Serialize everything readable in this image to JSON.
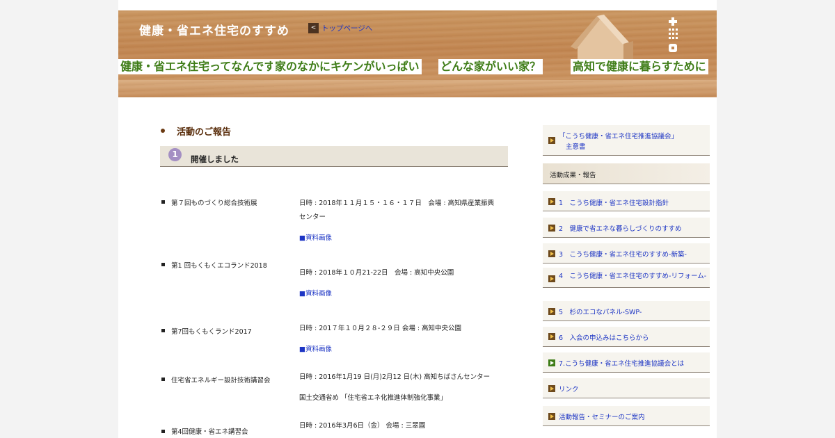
{
  "header": {
    "site_title": "健康・省エネ住宅のすすめ",
    "top_link": {
      "arrow": "<",
      "label": "トップページへ"
    },
    "nav": [
      "健康・省エネ住宅ってなんですか？",
      "家のなかにキケンがいっぱい",
      "どんな家がいい家？",
      "高知で健康に暮らすために"
    ]
  },
  "main": {
    "section_title": "活動のご報告",
    "banner": {
      "number": "1",
      "title": "開催しました"
    },
    "events": [
      {
        "name": "第７回ものづくり総合技術展",
        "lines": [
          "日時 : 2018年１１月１５・１６・１７日　会場 : 高知県産業振興",
          "センター"
        ],
        "link": "■資料画像"
      },
      {
        "name": "第1 回もくもくエコランド2018",
        "lines": [
          "日時 : 2018年１０月21-22日　会場 : 高知中央公園"
        ],
        "link": "■資料画像"
      },
      {
        "name": "第7回もくもくランド2017",
        "lines": [
          "日時 : 201７年１０月２８-２９日 会場 : 高知中央公園"
        ],
        "link": "■資料画像"
      },
      {
        "name": "住宅省エネルギー設計技術講習会",
        "lines": [
          "日時 : 2016年1月19 日(月)2月12 日(木) 高知ちばさんセンター",
          "国土交通省め 「住宅省エネ化推進体制強化事業」"
        ]
      },
      {
        "name": "第4回健康・省エネ講習会",
        "lines": [
          "日時 : 2016年3月6日（金） 会場 : 三翠園"
        ]
      }
    ]
  },
  "sidebar": {
    "prospectus": [
      "「こうち健康・省エネ住宅推進協議会」",
      "主意書"
    ],
    "section_head": "活動成果・報告",
    "items": [
      "1　こうち健康・省エネ住宅設計指針",
      "2　健康で省エネな暮らしづくりのすすめ",
      "3　こうち健康・省エネ住宅のすすめ-新築-",
      "4　こうち健康・省エネ住宅のすすめ-リフォーム-",
      "5　杉のエコなパネル-SWP-",
      "6　入会の申込みはこちらから",
      "7.こうち健康・省エネ住宅推進協議会とは",
      "リンク",
      "活動報告・セミナーのご案内"
    ]
  },
  "colors": {
    "header_wood": "#c18550",
    "nav_green": "#3f7d18",
    "link_blue": "#1d35c4",
    "heading_brown": "#5a2e0c",
    "banner_bg": "#e9e4d9",
    "badge_purple": "#a48fc3"
  },
  "icons": [
    "arrow-left-icon",
    "house-icon",
    "dot-grid-menu-icon",
    "bullet-icon",
    "number-badge-icon",
    "arrow-right-icon"
  ]
}
